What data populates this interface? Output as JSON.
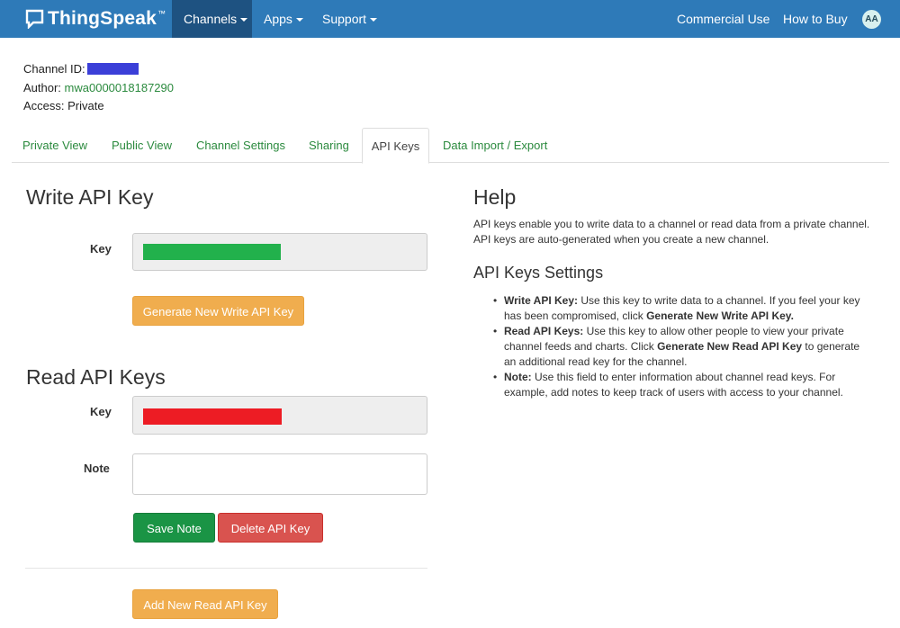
{
  "navbar": {
    "brand": "ThingSpeak",
    "brand_tm": "™",
    "items": [
      {
        "label": "Channels",
        "active": true
      },
      {
        "label": "Apps"
      },
      {
        "label": "Support"
      }
    ],
    "right_links": [
      "Commercial Use",
      "How to Buy"
    ],
    "avatar_initials": "AA",
    "colors": {
      "bar": "#2e7ab8",
      "active": "#1e5281"
    }
  },
  "channel": {
    "id_label": "Channel ID:",
    "author_label": "Author:",
    "author_value": "mwa0000018187290",
    "access_label": "Access:",
    "access_value": "Private"
  },
  "tabs": [
    {
      "label": "Private View"
    },
    {
      "label": "Public View"
    },
    {
      "label": "Channel Settings"
    },
    {
      "label": "Sharing"
    },
    {
      "label": "API Keys",
      "active": true
    },
    {
      "label": "Data Import / Export"
    }
  ],
  "write_key": {
    "title": "Write API Key",
    "key_label": "Key",
    "redaction_color": "#22b14c",
    "generate_label": "Generate New Write API Key"
  },
  "read_keys": {
    "title": "Read API Keys",
    "key_label": "Key",
    "redaction_color": "#ed1c24",
    "note_label": "Note",
    "note_value": "",
    "save_label": "Save Note",
    "delete_label": "Delete API Key",
    "add_label": "Add New Read API Key"
  },
  "help": {
    "title": "Help",
    "intro": "API keys enable you to write data to a channel or read data from a private channel. API keys are auto-generated when you create a new channel.",
    "settings_title": "API Keys Settings",
    "items": [
      {
        "term": "Write API Key:",
        "text": " Use this key to write data to a channel. If you feel your key has been compromised, click ",
        "bold": "Generate New Write API Key.",
        "tail": ""
      },
      {
        "term": "Read API Keys:",
        "text": " Use this key to allow other people to view your private channel feeds and charts. Click ",
        "bold": "Generate New Read API Key",
        "tail": " to generate an additional read key for the channel."
      },
      {
        "term": "Note:",
        "text": " Use this field to enter information about channel read keys. For example, add notes to keep track of users with access to your channel.",
        "bold": "",
        "tail": ""
      }
    ]
  }
}
